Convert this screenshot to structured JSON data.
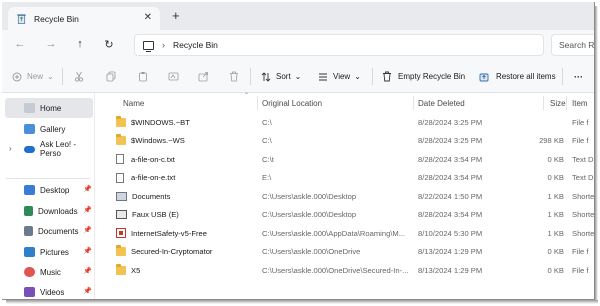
{
  "window": {
    "tab_title": "Recycle Bin",
    "new_tab": "+",
    "close_tab": "✕"
  },
  "navigation": {
    "back": "←",
    "forward": "→",
    "up": "↑",
    "refresh": "↻",
    "breadcrumb_separator": "›",
    "address": "Recycle Bin",
    "search_placeholder": "Search R"
  },
  "toolbar": {
    "new_label": "New",
    "new_chevron": "⌄",
    "sort_label": "Sort",
    "view_label": "View",
    "empty_label": "Empty Recycle Bin",
    "restore_all_label": "Restore all items",
    "more_label": "···"
  },
  "sidebar": {
    "items": [
      {
        "label": "Home",
        "icon": "home-icon",
        "selected": true
      },
      {
        "label": "Gallery",
        "icon": "gallery-icon"
      },
      {
        "label": "Ask Leo! - Perso",
        "icon": "onedrive-icon"
      },
      {
        "label": "Desktop",
        "icon": "desktop-icon",
        "pinned": true
      },
      {
        "label": "Downloads",
        "icon": "downloads-icon",
        "pinned": true
      },
      {
        "label": "Documents",
        "icon": "documents-icon",
        "pinned": true
      },
      {
        "label": "Pictures",
        "icon": "pictures-icon",
        "pinned": true
      },
      {
        "label": "Music",
        "icon": "music-icon",
        "pinned": true
      },
      {
        "label": "Videos",
        "icon": "videos-icon",
        "pinned": true
      }
    ],
    "pin_glyph": "📌",
    "expand_glyph": "›"
  },
  "table": {
    "columns": [
      "Name",
      "Original Location",
      "Date Deleted",
      "Size",
      "Item"
    ],
    "rows": [
      {
        "name": "$WINDOWS.~BT",
        "location": "C:\\",
        "date": "8/28/2024 3:25 PM",
        "size": "",
        "type": "File f",
        "icon": "folder"
      },
      {
        "name": "$Windows.~WS",
        "location": "C:\\",
        "date": "8/28/2024 3:25 PM",
        "size": "298 KB",
        "type": "File f",
        "icon": "folder"
      },
      {
        "name": "a-file-on-c.txt",
        "location": "C:\\t",
        "date": "8/28/2024 3:54 PM",
        "size": "0 KB",
        "type": "Text D",
        "icon": "txt"
      },
      {
        "name": "a-file-on-e.txt",
        "location": "E:\\",
        "date": "8/28/2024 3:54 PM",
        "size": "0 KB",
        "type": "Text D",
        "icon": "txt"
      },
      {
        "name": "Documents",
        "location": "C:\\Users\\askle.000\\Desktop",
        "date": "8/22/2024 1:50 PM",
        "size": "1 KB",
        "type": "Shorte",
        "icon": "lnk"
      },
      {
        "name": "Faux USB (E)",
        "location": "C:\\Users\\askle.000\\Desktop",
        "date": "8/28/2024 3:54 PM",
        "size": "1 KB",
        "type": "Shorte",
        "icon": "usb"
      },
      {
        "name": "InternetSafety-v5-Free",
        "location": "C:\\Users\\askle.000\\AppData\\Roaming\\M...",
        "date": "8/10/2024 5:30 PM",
        "size": "1 KB",
        "type": "Shorte",
        "icon": "exe"
      },
      {
        "name": "Secured-In-Cryptomator",
        "location": "C:\\Users\\askle.000\\OneDrive",
        "date": "8/13/2024 1:29 PM",
        "size": "0 KB",
        "type": "File f",
        "icon": "folder"
      },
      {
        "name": "X5",
        "location": "C:\\Users\\askle.000\\OneDrive\\Secured-In-...",
        "date": "8/13/2024 1:29 PM",
        "size": "0 KB",
        "type": "File f",
        "icon": "folder"
      }
    ]
  },
  "colors": {
    "accent": "#2b6cb0",
    "folder": "#f2c352",
    "selected_bg": "#e4e6ea"
  }
}
